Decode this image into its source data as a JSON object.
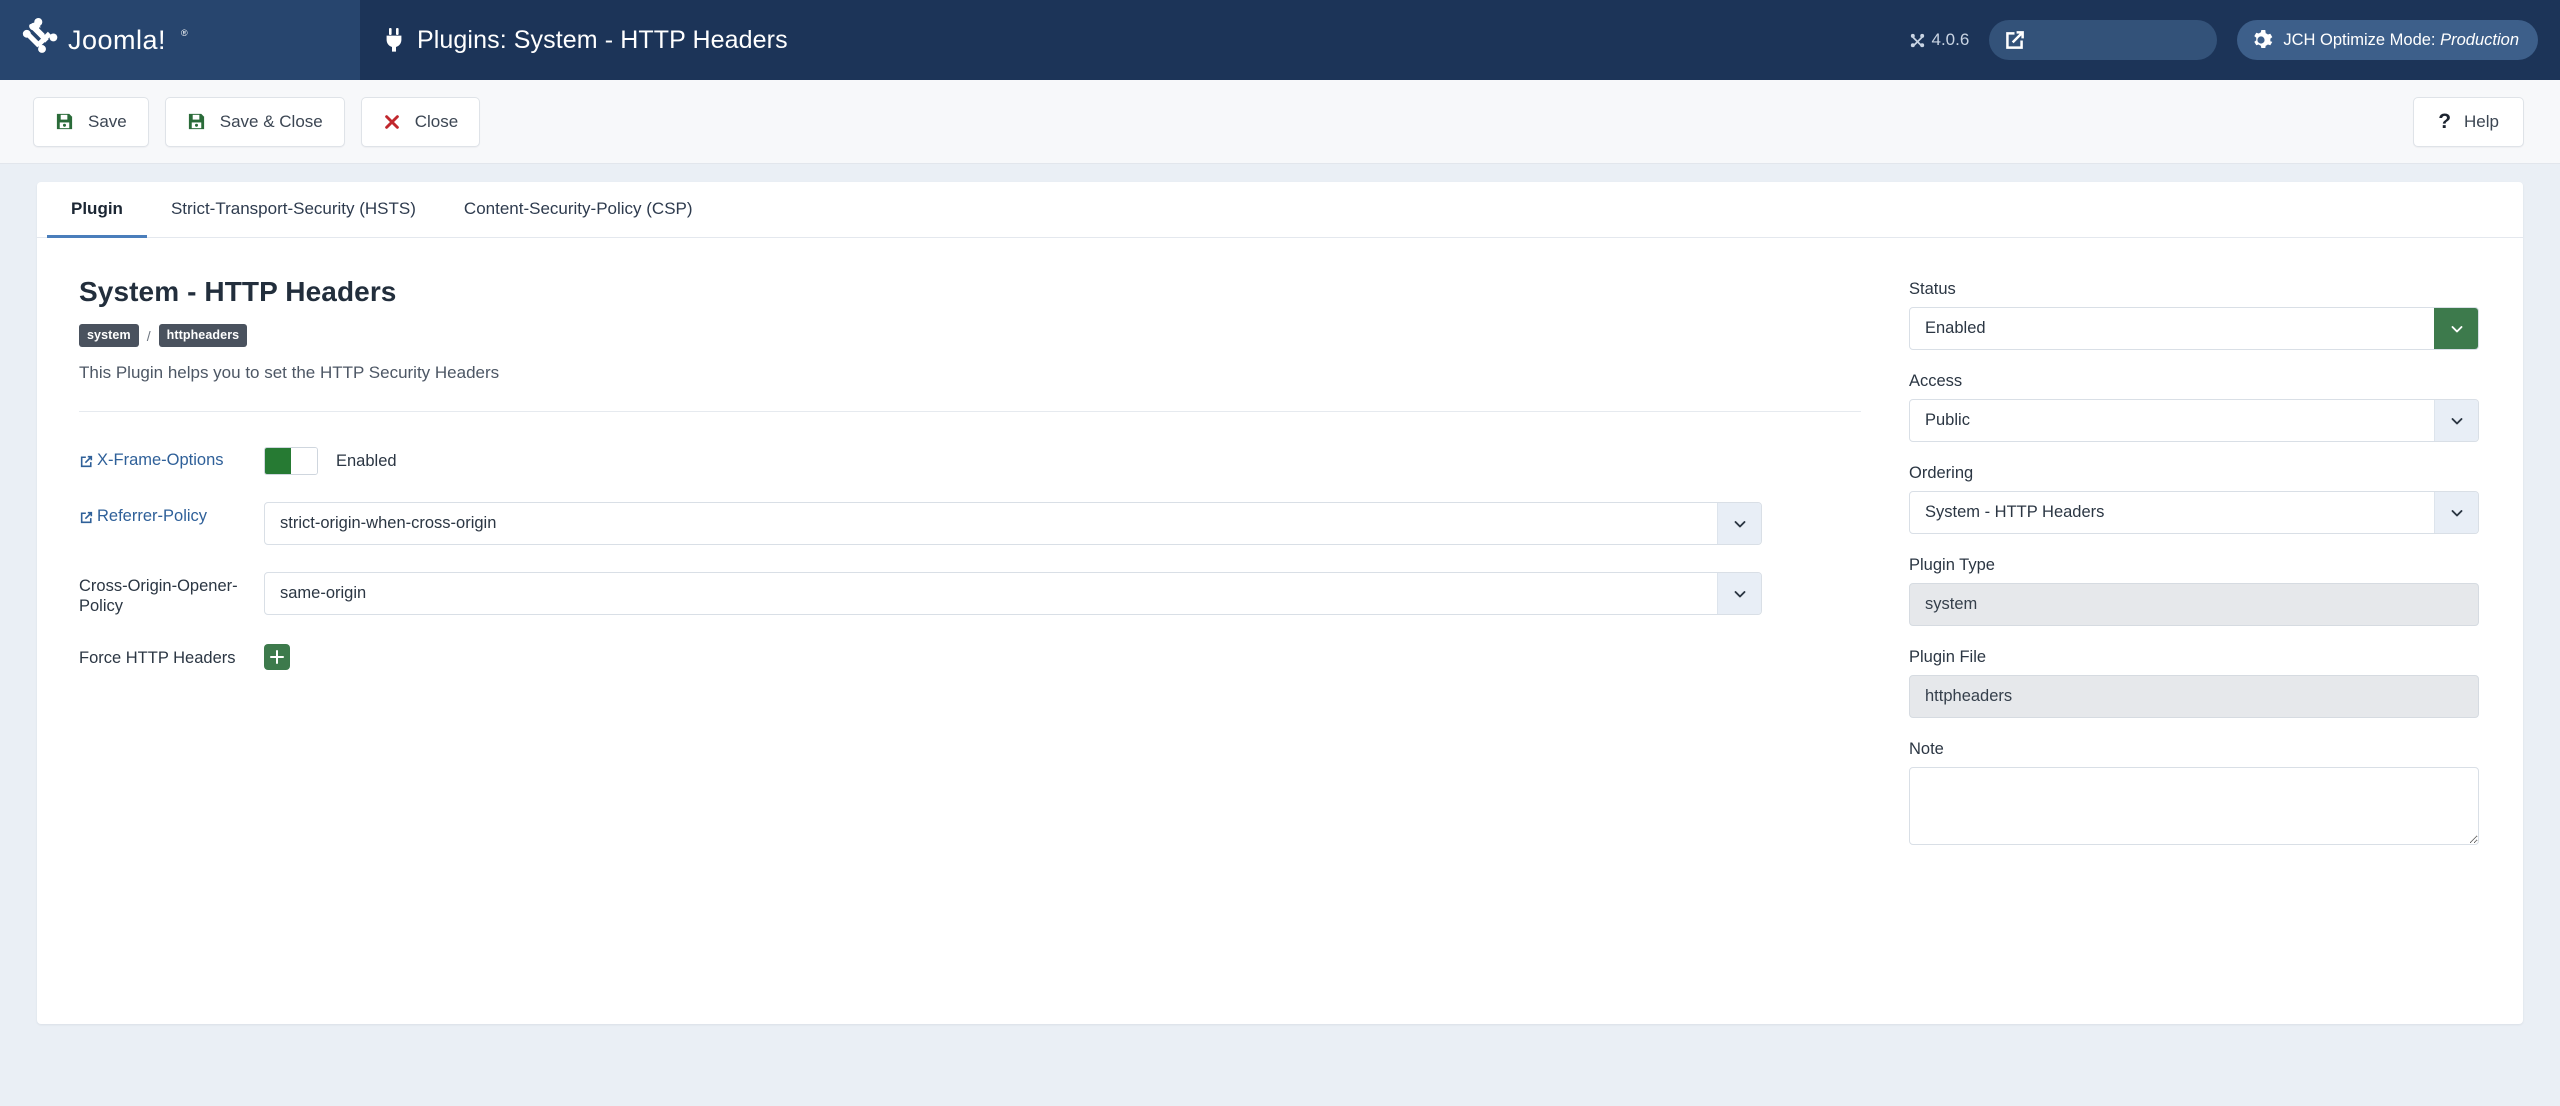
{
  "header": {
    "logo_alt": "Joomla!",
    "page_title": "Plugins: System - HTTP Headers",
    "version": "4.0.6",
    "preview_label": "",
    "jch_label": "JCH Optimize Mode: ",
    "jch_mode": "Production"
  },
  "toolbar": {
    "save_label": "Save",
    "save_close_label": "Save & Close",
    "close_label": "Close",
    "help_label": "Help",
    "help_glyph": "?"
  },
  "tabs": [
    {
      "label": "Plugin",
      "active": true
    },
    {
      "label": "Strict-Transport-Security (HSTS)",
      "active": false
    },
    {
      "label": "Content-Security-Policy (CSP)",
      "active": false
    }
  ],
  "plugin": {
    "title": "System - HTTP Headers",
    "badge_type": "system",
    "badge_sep": "/",
    "badge_file": "httpheaders",
    "description": "This Plugin helps you to set the HTTP Security Headers"
  },
  "fields": {
    "xframe": {
      "label": "X-Frame-Options",
      "toggle_state": "Enabled",
      "toggle_on": true
    },
    "referrer": {
      "label": "Referrer-Policy",
      "value": "strict-origin-when-cross-origin"
    },
    "coop": {
      "label": "Cross-Origin-Opener-Policy",
      "value": "same-origin"
    },
    "force_headers": {
      "label": "Force HTTP Headers",
      "add_glyph": "+"
    }
  },
  "sidebar": {
    "status_label": "Status",
    "status_value": "Enabled",
    "access_label": "Access",
    "access_value": "Public",
    "ordering_label": "Ordering",
    "ordering_value": "System - HTTP Headers",
    "plugin_type_label": "Plugin Type",
    "plugin_type_value": "system",
    "plugin_file_label": "Plugin File",
    "plugin_file_value": "httpheaders",
    "note_label": "Note",
    "note_value": "",
    "note_placeholder": ""
  },
  "colors": {
    "header_bg": "#1c3458",
    "logo_bg": "#27456e",
    "accent_green": "#3d7a4c",
    "toggle_green": "#267a33",
    "tab_active": "#4a7ebb",
    "link_blue": "#2f6099",
    "danger_red": "#c1272d",
    "page_bg": "#eaeff5"
  }
}
